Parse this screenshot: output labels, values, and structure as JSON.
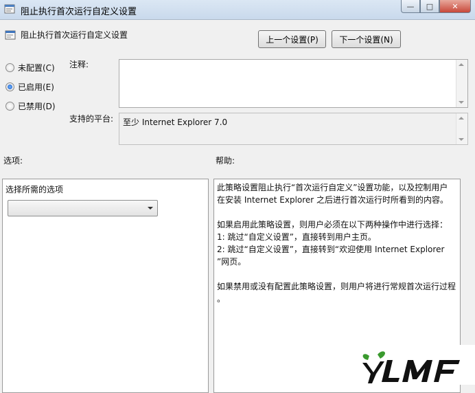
{
  "window": {
    "title": "阻止执行首次运行自定义设置",
    "minimize": "—",
    "maximize": "□",
    "close": "✕"
  },
  "header": {
    "title": "阻止执行首次运行自定义设置",
    "prev_button": "上一个设置(P)",
    "next_button": "下一个设置(N)"
  },
  "state_options": [
    {
      "label": "未配置(C)",
      "checked": false
    },
    {
      "label": "已启用(E)",
      "checked": true
    },
    {
      "label": "已禁用(D)",
      "checked": false
    }
  ],
  "comment": {
    "label": "注释:",
    "value": ""
  },
  "platform": {
    "label": "支持的平台:",
    "value": "至少 Internet Explorer 7.0"
  },
  "options": {
    "label": "选项:",
    "select_label": "选择所需的选项",
    "select_value": ""
  },
  "help": {
    "label": "帮助:",
    "lines": [
      "此策略设置阻止执行“首次运行自定义”设置功能，以及控制用户",
      "在安装 Internet Explorer 之后进行首次运行时所看到的内容。",
      "",
      "如果启用此策略设置，则用户必须在以下两种操作中进行选择：",
      "1: 跳过“自定义设置”，直接转到用户主页。",
      "2: 跳过“自定义设置”，直接转到“欢迎使用 Internet Explorer",
      "”网页。",
      "",
      "如果禁用或没有配置此策略设置，则用户将进行常规首次运行过程",
      "。"
    ]
  },
  "watermark": {
    "text": "YLMF",
    "colors": {
      "leaf": "#3a9a2e",
      "text": "#111111"
    }
  }
}
